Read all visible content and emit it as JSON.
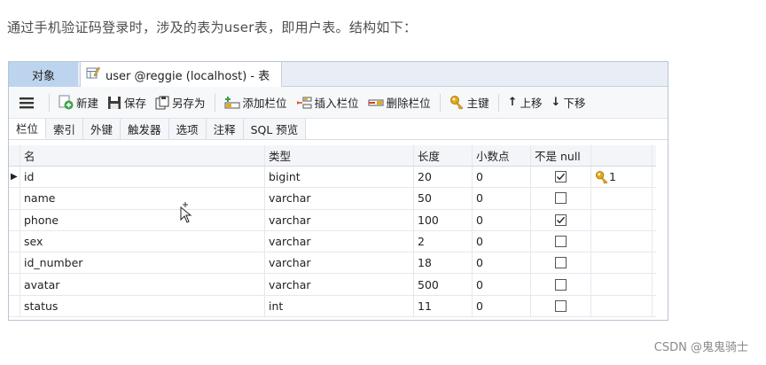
{
  "intro": "通过手机验证码登录时，涉及的表为user表，即用户表。结构如下：",
  "tabs": {
    "objects": "对象",
    "document": "user @reggie (localhost) - 表"
  },
  "toolbar": {
    "new": "新建",
    "save": "保存",
    "save_as": "另存为",
    "add_field": "添加栏位",
    "insert_field": "插入栏位",
    "delete_field": "删除栏位",
    "primary_key": "主键",
    "move_up": "上移",
    "move_down": "下移"
  },
  "subtabs": [
    "栏位",
    "索引",
    "外键",
    "触发器",
    "选项",
    "注释",
    "SQL 预览"
  ],
  "columns": {
    "name": "名",
    "type": "类型",
    "length": "长度",
    "decimals": "小数点",
    "not_null": "不是 null"
  },
  "rows": [
    {
      "name": "id",
      "type": "bigint",
      "length": "20",
      "decimals": "0",
      "not_null": true,
      "key": "1"
    },
    {
      "name": "name",
      "type": "varchar",
      "length": "50",
      "decimals": "0",
      "not_null": false,
      "key": ""
    },
    {
      "name": "phone",
      "type": "varchar",
      "length": "100",
      "decimals": "0",
      "not_null": true,
      "key": ""
    },
    {
      "name": "sex",
      "type": "varchar",
      "length": "2",
      "decimals": "0",
      "not_null": false,
      "key": ""
    },
    {
      "name": "id_number",
      "type": "varchar",
      "length": "18",
      "decimals": "0",
      "not_null": false,
      "key": ""
    },
    {
      "name": "avatar",
      "type": "varchar",
      "length": "500",
      "decimals": "0",
      "not_null": false,
      "key": ""
    },
    {
      "name": "status",
      "type": "int",
      "length": "11",
      "decimals": "0",
      "not_null": false,
      "key": ""
    }
  ],
  "watermark": "CSDN @鬼鬼骑士",
  "colors": {
    "tab_active": "#bcd4ee",
    "border": "#b9c4d4",
    "key_gold": "#e6a91b"
  }
}
